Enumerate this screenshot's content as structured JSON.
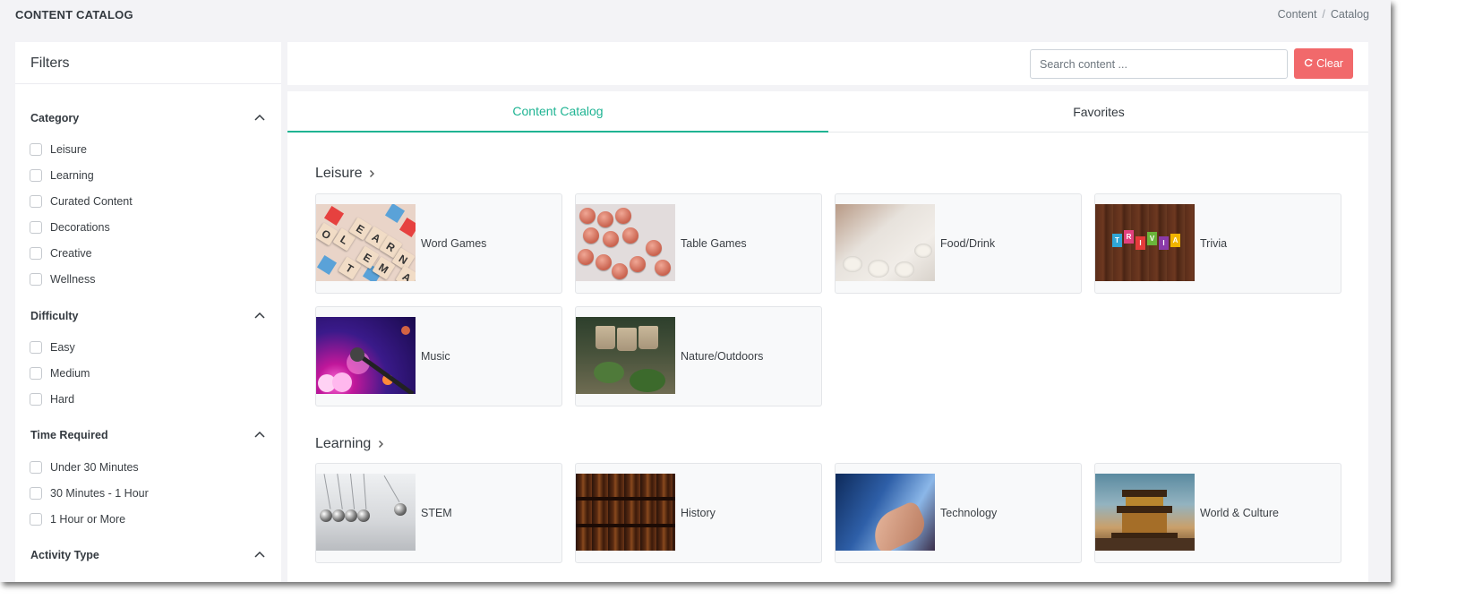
{
  "header": {
    "title": "CONTENT CATALOG",
    "breadcrumb": [
      "Content",
      "Catalog"
    ],
    "breadcrumb_separator": "/"
  },
  "sidebar": {
    "title": "Filters",
    "groups": [
      {
        "title": "Category",
        "options": [
          "Leisure",
          "Learning",
          "Curated Content",
          "Decorations",
          "Creative",
          "Wellness"
        ]
      },
      {
        "title": "Difficulty",
        "options": [
          "Easy",
          "Medium",
          "Hard"
        ]
      },
      {
        "title": "Time Required",
        "options": [
          "Under 30 Minutes",
          "30 Minutes - 1 Hour",
          "1 Hour or More"
        ]
      },
      {
        "title": "Activity Type",
        "options": []
      }
    ]
  },
  "search": {
    "placeholder": "Search content ...",
    "value": "",
    "clear_label": "Clear"
  },
  "tabs": [
    {
      "label": "Content Catalog",
      "active": true
    },
    {
      "label": "Favorites",
      "active": false
    }
  ],
  "sections": [
    {
      "title": "Leisure",
      "cards": [
        "Word Games",
        "Table Games",
        "Food/Drink",
        "Trivia",
        "Music",
        "Nature/Outdoors"
      ]
    },
    {
      "title": "Learning",
      "cards": [
        "STEM",
        "History",
        "Technology",
        "World & Culture"
      ]
    }
  ],
  "trivia_letters": [
    "T",
    "R",
    "I",
    "V",
    "I",
    "A"
  ],
  "colors": {
    "accent": "#1fb493",
    "clear_button": "#f1696b",
    "background": "#f3f3f6"
  },
  "icons": {
    "collapse": "chevron-up-icon",
    "section_link": "chevron-right-icon",
    "clear": "refresh-icon"
  }
}
